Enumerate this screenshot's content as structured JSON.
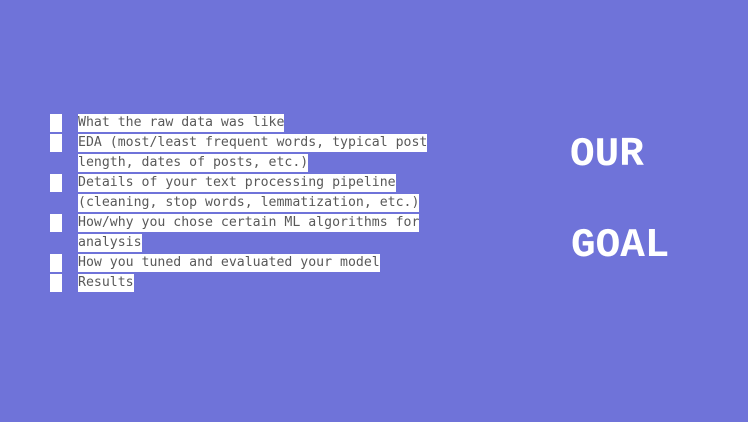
{
  "slide": {
    "background": "#6f73d9",
    "bullets": [
      {
        "lines": [
          "What the raw data was like"
        ]
      },
      {
        "lines": [
          "EDA (most/least frequent words, typical post",
          "length, dates of posts, etc.)"
        ]
      },
      {
        "lines": [
          "Details of your text processing pipeline",
          "(cleaning, stop words, lemmatization, etc.)"
        ]
      },
      {
        "lines": [
          "How/why you chose certain ML algorithms for",
          "analysis"
        ]
      },
      {
        "lines": [
          "How you tuned and evaluated your model"
        ]
      },
      {
        "lines": [
          "Results"
        ]
      }
    ],
    "heading": {
      "line1": "OUR",
      "line2": "GOAL"
    }
  }
}
